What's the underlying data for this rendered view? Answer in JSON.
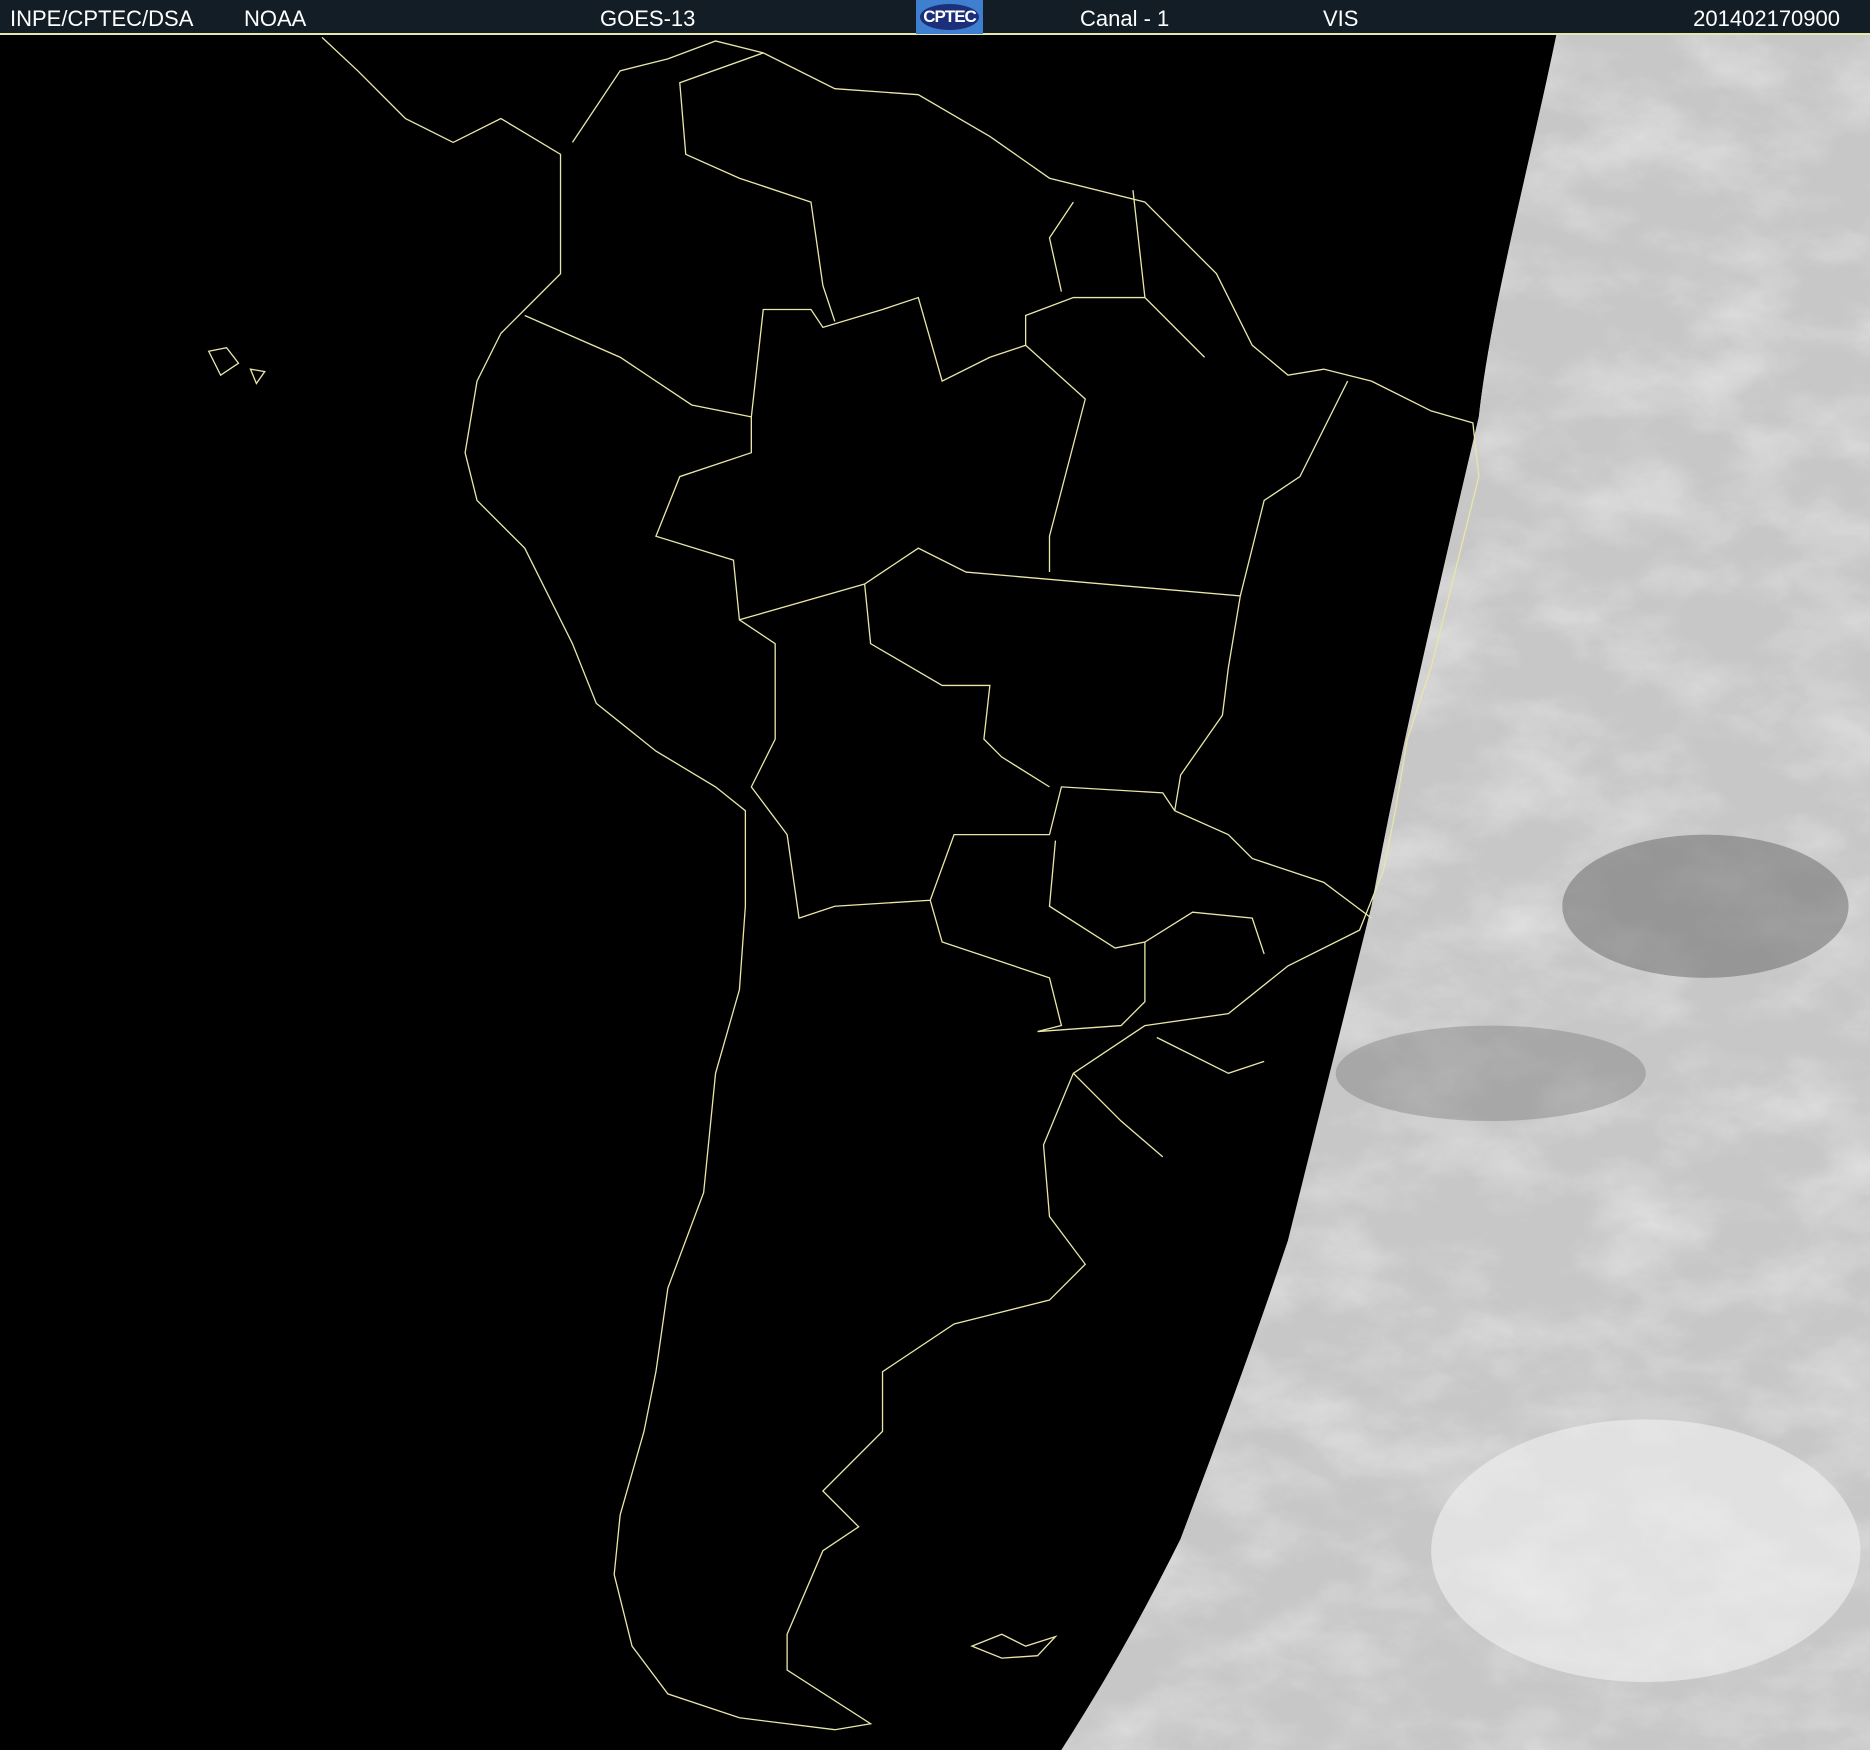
{
  "header": {
    "agency": "INPE/CPTEC/DSA",
    "source": "NOAA",
    "satellite": "GOES-13",
    "logo_text": "CPTEC",
    "channel": "Canal - 1",
    "band": "VIS",
    "timestamp": "201402170900"
  },
  "colors": {
    "header_bg": "#121d26",
    "coastline": "#e8e6a8",
    "night": "#000000",
    "cloud": "#e8e8e8"
  }
}
